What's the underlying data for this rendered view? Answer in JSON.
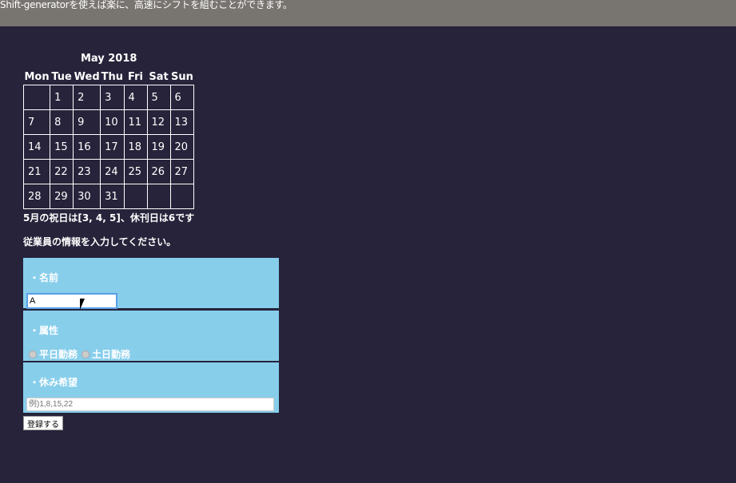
{
  "header": {
    "text": "Shift-generatorを使えば楽に、高速にシフトを組むことができます。"
  },
  "calendar": {
    "title": "May 2018",
    "weekdays": [
      "Mon",
      "Tue",
      "Wed",
      "Thu",
      "Fri",
      "Sat",
      "Sun"
    ],
    "weeks": [
      [
        "",
        "1",
        "2",
        "3",
        "4",
        "5",
        "6"
      ],
      [
        "7",
        "8",
        "9",
        "10",
        "11",
        "12",
        "13"
      ],
      [
        "14",
        "15",
        "16",
        "17",
        "18",
        "19",
        "20"
      ],
      [
        "21",
        "22",
        "23",
        "24",
        "25",
        "26",
        "27"
      ],
      [
        "28",
        "29",
        "30",
        "31",
        "",
        "",
        ""
      ]
    ]
  },
  "holiday_note": "5月の祝日は[3, 4, 5]、休刊日は6です",
  "instruction": "従業員の情報を入力してください。",
  "form": {
    "name_label": "・名前",
    "name_value": "A",
    "attr_label": "・属性",
    "attr_options": [
      "平日勤務",
      "土日勤務"
    ],
    "holiday_label": "・休み希望",
    "holiday_placeholder": "例)1,8,15,22",
    "submit_label": "登録する"
  },
  "colors": {
    "header": "#787470",
    "background": "#26233a",
    "panel": "#87ceeb"
  }
}
